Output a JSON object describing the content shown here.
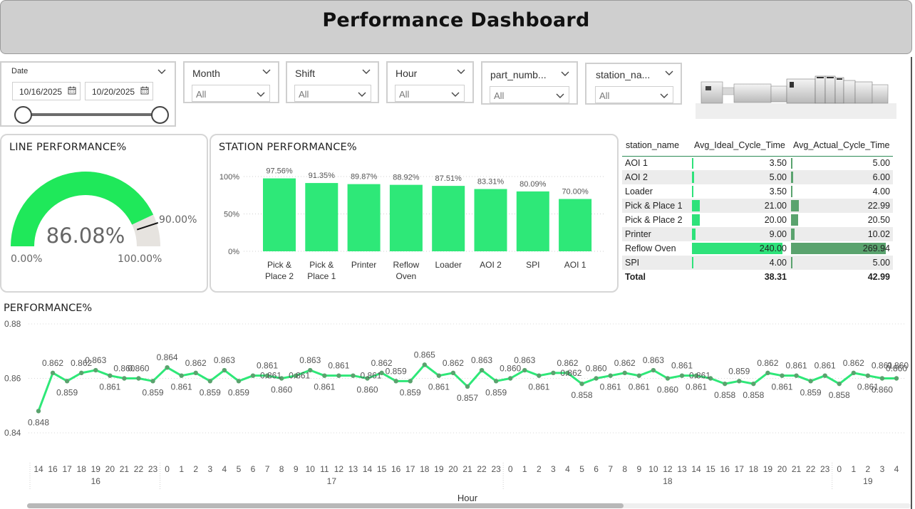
{
  "header": {
    "title": "Performance Dashboard"
  },
  "date_slicer": {
    "title": "Date",
    "start": "10/16/2025",
    "end": "10/20/2025",
    "range_start_fraction": 0.0,
    "range_end_fraction": 1.0
  },
  "slicers": [
    {
      "title": "Month",
      "value": "All"
    },
    {
      "title": "Shift",
      "value": "All"
    },
    {
      "title": "Hour",
      "value": "All"
    },
    {
      "title": "part_numb...",
      "value": "All"
    },
    {
      "title": "station_na...",
      "value": "All"
    }
  ],
  "gauge": {
    "title": "LINE PERFORMANCE%",
    "value": 0.8608,
    "value_label": "86.08%",
    "min_label": "0.00%",
    "max_label": "100.00%",
    "target": 0.9,
    "target_label": "90.00%",
    "fill_color": "#1fe85a",
    "track_color": "#e6e3df"
  },
  "station_chart": {
    "title": "STATION PERFORMANCE%",
    "chart_data": {
      "type": "bar",
      "categories": [
        "Pick & Place 2",
        "Pick & Place 1",
        "Printer",
        "Reflow Oven",
        "Loader",
        "AOI 2",
        "SPI",
        "AOI 1"
      ],
      "category_lines": [
        [
          "Pick &",
          "Place 2"
        ],
        [
          "Pick &",
          "Place 1"
        ],
        [
          "Printer"
        ],
        [
          "Reflow",
          "Oven"
        ],
        [
          "Loader"
        ],
        [
          "AOI 2"
        ],
        [
          "SPI"
        ],
        [
          "AOI 1"
        ]
      ],
      "values": [
        97.56,
        91.35,
        89.87,
        88.92,
        87.51,
        83.31,
        80.09,
        70.0
      ],
      "value_labels": [
        "97.56%",
        "91.35%",
        "89.87%",
        "88.92%",
        "87.51%",
        "83.31%",
        "80.09%",
        "70.00%"
      ],
      "yticks": [
        "100%",
        "50%",
        "0%"
      ],
      "ylim": [
        0,
        100
      ],
      "color": "#2ee878"
    }
  },
  "table": {
    "columns": [
      "station_name",
      "Avg_Ideal_Cycle_Time",
      "Avg_Actual_Cycle_Time"
    ],
    "rows": [
      {
        "station": "AOI 1",
        "ideal": "3.50",
        "actual": "5.00",
        "ideal_v": 3.5,
        "actual_v": 5.0
      },
      {
        "station": "AOI 2",
        "ideal": "5.00",
        "actual": "6.00",
        "ideal_v": 5.0,
        "actual_v": 6.0
      },
      {
        "station": "Loader",
        "ideal": "3.50",
        "actual": "4.00",
        "ideal_v": 3.5,
        "actual_v": 4.0
      },
      {
        "station": "Pick & Place 1",
        "ideal": "21.00",
        "actual": "22.99",
        "ideal_v": 21.0,
        "actual_v": 22.99
      },
      {
        "station": "Pick & Place 2",
        "ideal": "20.00",
        "actual": "20.50",
        "ideal_v": 20.0,
        "actual_v": 20.5
      },
      {
        "station": "Printer",
        "ideal": "9.00",
        "actual": "10.02",
        "ideal_v": 9.0,
        "actual_v": 10.02
      },
      {
        "station": "Reflow Oven",
        "ideal": "240.00",
        "actual": "269.94",
        "ideal_v": 240.0,
        "actual_v": 269.94
      },
      {
        "station": "SPI",
        "ideal": "4.00",
        "actual": "5.00",
        "ideal_v": 4.0,
        "actual_v": 5.0
      }
    ],
    "total": {
      "label": "Total",
      "ideal": "38.31",
      "actual": "42.99"
    }
  },
  "line_chart": {
    "title": "PERFORMANCE%",
    "chart_data": {
      "type": "line",
      "xlabel": "Hour",
      "ylim": [
        0.84,
        0.88
      ],
      "yticks": [
        "0.88",
        "0.86",
        "0.84"
      ],
      "color": "#2ee878",
      "x": [
        "14",
        "16",
        "17",
        "18",
        "19",
        "20",
        "21",
        "22",
        "23",
        "0",
        "1",
        "2",
        "3",
        "4",
        "5",
        "6",
        "7",
        "8",
        "9",
        "10",
        "11",
        "12",
        "13",
        "14",
        "15",
        "16",
        "17",
        "18",
        "19",
        "20",
        "21",
        "22",
        "23",
        "0",
        "1",
        "2",
        "3",
        "4",
        "5",
        "6",
        "7",
        "8",
        "9",
        "10",
        "12",
        "13",
        "14",
        "15",
        "16",
        "17",
        "18",
        "19",
        "20",
        "21",
        "22",
        "23",
        "0",
        "1",
        "2",
        "3",
        "4"
      ],
      "values": [
        0.848,
        0.862,
        0.859,
        0.862,
        0.863,
        0.861,
        0.86,
        0.86,
        0.859,
        0.864,
        0.861,
        0.862,
        0.859,
        0.863,
        0.859,
        0.861,
        0.861,
        0.86,
        0.861,
        0.863,
        0.861,
        0.861,
        0.861,
        0.86,
        0.862,
        0.859,
        0.859,
        0.865,
        0.861,
        0.862,
        0.857,
        0.863,
        0.859,
        0.86,
        0.863,
        0.861,
        0.862,
        0.862,
        0.858,
        0.86,
        0.861,
        0.862,
        0.861,
        0.863,
        0.86,
        0.861,
        0.861,
        0.86,
        0.858,
        0.859,
        0.858,
        0.862,
        0.861,
        0.861,
        0.859,
        0.861,
        0.858,
        0.862,
        0.861,
        0.86,
        0.86
      ],
      "labels": [
        "0.848",
        "0.862",
        "0.859",
        "0.862",
        "0.863",
        "0.861",
        "0.860",
        "",
        "0.859",
        "0.864",
        "0.861",
        "0.862",
        "0.859",
        "0.863",
        "0.859",
        "",
        "0.861",
        "0.860",
        "",
        "0.863",
        "0.861",
        "0.861",
        "",
        "0.860",
        "0.862",
        "0.859",
        "0.859",
        "0.865",
        "0.861",
        "0.862",
        "0.857",
        "0.863",
        "0.859",
        "0.860",
        "0.863",
        "0.861",
        "",
        "0.862",
        "0.858",
        "0.860",
        "0.861",
        "0.862",
        "0.861",
        "0.863",
        "0.860",
        "0.861",
        "0.861",
        "",
        "0.858",
        "0.859",
        "0.858",
        "0.862",
        "0.861",
        "0.861",
        "0.859",
        "0.861",
        "0.858",
        "0.862",
        "0.861",
        "0.860",
        "0.860"
      ],
      "label_pos": [
        "b",
        "a",
        "b",
        "a",
        "a",
        "b",
        "a",
        "n",
        "b",
        "a",
        "b",
        "a",
        "b",
        "a",
        "b",
        "n",
        "a",
        "b",
        "n",
        "a",
        "b",
        "a",
        "n",
        "b",
        "a",
        "a",
        "b",
        "a",
        "b",
        "a",
        "b",
        "a",
        "b",
        "a",
        "a",
        "b",
        "n",
        "a",
        "b",
        "a",
        "b",
        "a",
        "b",
        "a",
        "b",
        "a",
        "b",
        "n",
        "b",
        "a",
        "b",
        "a",
        "b",
        "a",
        "b",
        "a",
        "b",
        "a",
        "b",
        "b",
        "a"
      ],
      "extra_labels": [
        [
          "0.860",
          7,
          0.86,
          "a"
        ],
        [
          "0.860",
          15,
          0.86,
          "n"
        ],
        [
          "0.861",
          15,
          0.861,
          "r"
        ],
        [
          "0.861",
          17,
          0.861,
          "r"
        ],
        [
          "0.861",
          22,
          0.861,
          "r"
        ],
        [
          "0.862",
          36,
          0.862,
          "r"
        ],
        [
          "0.861",
          45,
          0.861,
          "r"
        ],
        [
          "0.861",
          59,
          0.861,
          "a"
        ],
        [
          "0.860",
          60,
          0.86,
          "a2"
        ]
      ],
      "day_groups": [
        {
          "label": "16",
          "start": 0,
          "end": 8
        },
        {
          "label": "17",
          "start": 9,
          "end": 32
        },
        {
          "label": "18",
          "start": 33,
          "end": 55
        },
        {
          "label": "19",
          "start": 56,
          "end": 60
        }
      ]
    }
  }
}
